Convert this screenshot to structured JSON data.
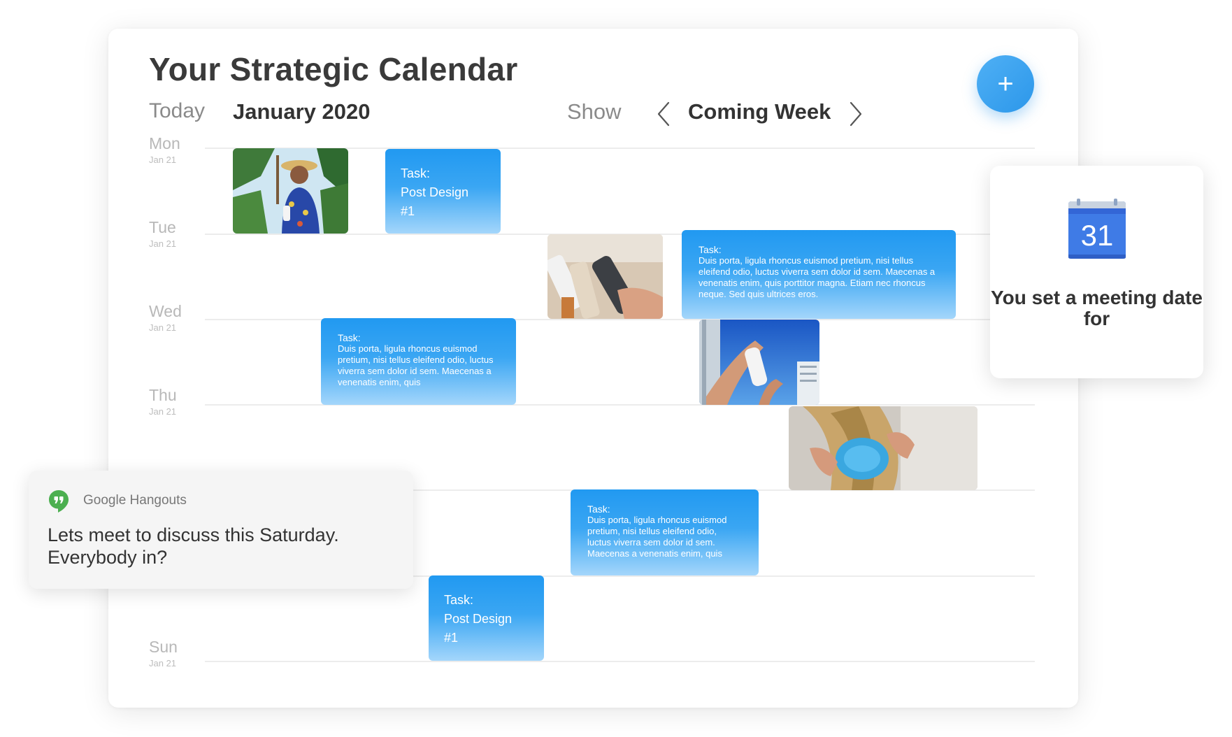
{
  "title": "Your Strategic Calendar",
  "toolbar": {
    "today": "Today",
    "month": "January 2020",
    "show": "Show",
    "range": "Coming Week",
    "add_icon": "plus-icon",
    "prev_icon": "chevron-left-icon",
    "next_icon": "chevron-right-icon"
  },
  "days": [
    {
      "name": "Mon",
      "date": "Jan 21"
    },
    {
      "name": "Tue",
      "date": "Jan 21"
    },
    {
      "name": "Wed",
      "date": "Jan 21"
    },
    {
      "name": "Thu",
      "date": "Jan 21"
    },
    {
      "name": "Sun",
      "date": "Jan 21"
    }
  ],
  "tasks": [
    {
      "label": "Task:",
      "text": "Post Design\n#1"
    },
    {
      "label": "Task:",
      "text": "Duis porta, ligula rhoncus euismod pretium, nisi tellus eleifend odio, luctus viverra sem dolor id sem. Maecenas a venenatis enim, quis porttitor magna. Etiam nec rhoncus neque. Sed quis ultrices eros."
    },
    {
      "label": "Task:",
      "text": "Duis porta, ligula rhoncus euismod pretium, nisi tellus eleifend odio, luctus viverra sem dolor id sem. Maecenas a venenatis enim, quis"
    },
    {
      "label": "Task:",
      "text": "Duis porta, ligula rhoncus euismod pretium, nisi tellus eleifend odio, luctus viverra sem dolor id sem. Maecenas a venenatis enim, quis"
    },
    {
      "label": "Task:",
      "text": "Post Design\n#1"
    }
  ],
  "google_calendar": {
    "icon": "google-calendar-icon",
    "icon_number": "31",
    "message": "You set a meeting date for"
  },
  "hangouts": {
    "icon": "google-hangouts-icon",
    "app": "Google Hangouts",
    "message": "Lets meet to discuss this Saturday. Everybody in?"
  },
  "colors": {
    "accent": "#2c97ea",
    "task_top": "#2199f1",
    "task_bottom": "#a4d6fb",
    "gcal_blue": "#4285f4",
    "hangouts_green": "#4caf50"
  }
}
